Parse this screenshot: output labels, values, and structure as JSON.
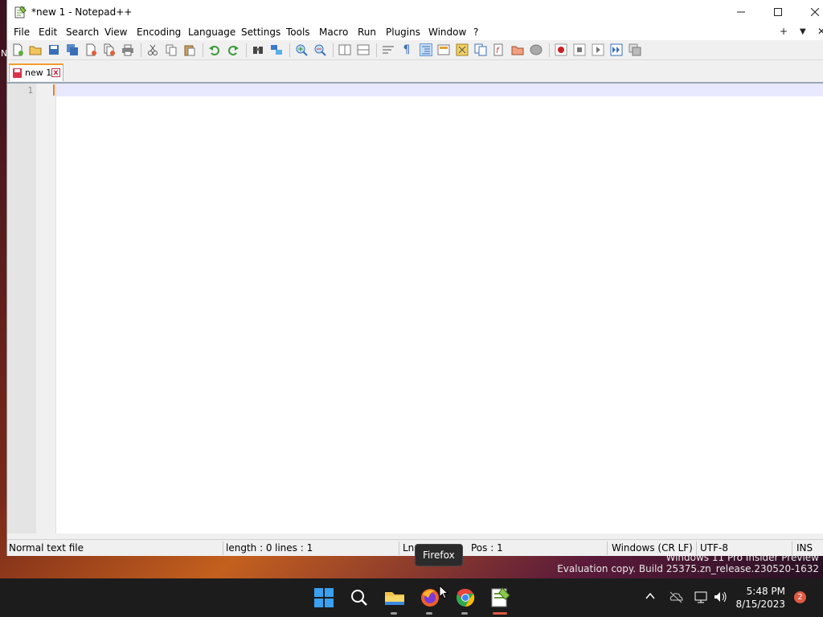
{
  "window": {
    "title": "*new 1 - Notepad++"
  },
  "menu": [
    "File",
    "Edit",
    "Search",
    "View",
    "Encoding",
    "Language",
    "Settings",
    "Tools",
    "Macro",
    "Run",
    "Plugins",
    "Window",
    "?"
  ],
  "menu_extras": {
    "add": "+",
    "dropdown": "▼",
    "close": "✕"
  },
  "tab": {
    "label": "new 1",
    "close": "x"
  },
  "editor": {
    "line_numbers": [
      "1"
    ]
  },
  "status": {
    "file_type": "Normal text file",
    "length": "length : 0",
    "lines": "lines : 1",
    "ln": "Ln",
    "pos": "Pos : 1",
    "eol": "Windows (CR LF)",
    "encoding": "UTF-8",
    "mode": "INS"
  },
  "watermark": {
    "line1": "Windows 11 Pro Insider Preview",
    "line2": "Evaluation copy. Build 25375.zn_release.230520-1632"
  },
  "tooltip": "Firefox",
  "clock": {
    "time": "5:48 PM",
    "date": "8/15/2023"
  },
  "notifications": "2",
  "left_edge_text": "N"
}
